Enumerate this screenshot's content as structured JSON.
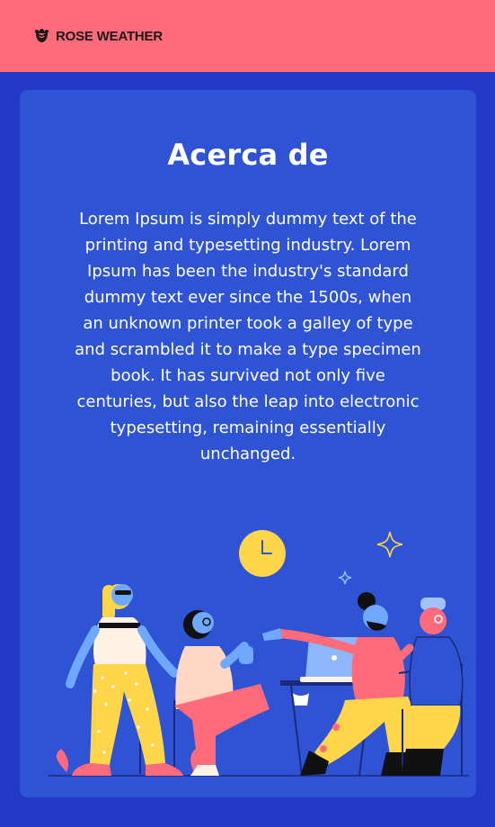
{
  "app": {
    "brand_name": "ROSE WEATHER",
    "brand_icon": "rose-icon"
  },
  "about": {
    "title": "Acerca de",
    "description": "Lorem Ipsum is simply dummy text of the printing and typesetting industry. Lorem Ipsum has been the industry's standard dummy text ever since the 1500s, when an unknown printer took a galley of type and scrambled it to make a type specimen book. It has survived not only five centuries, but also the leap into electronic typesetting, remaining essentially unchanged."
  },
  "colors": {
    "topbar": "#FF6B7A",
    "page_background": "#2338C6",
    "card_background": "#2E53D4",
    "text": "#FFFFFF",
    "accent_yellow": "#FFD54A",
    "accent_pink": "#FF6B7A"
  },
  "illustration": {
    "subject": "people-meeting-illustration"
  }
}
